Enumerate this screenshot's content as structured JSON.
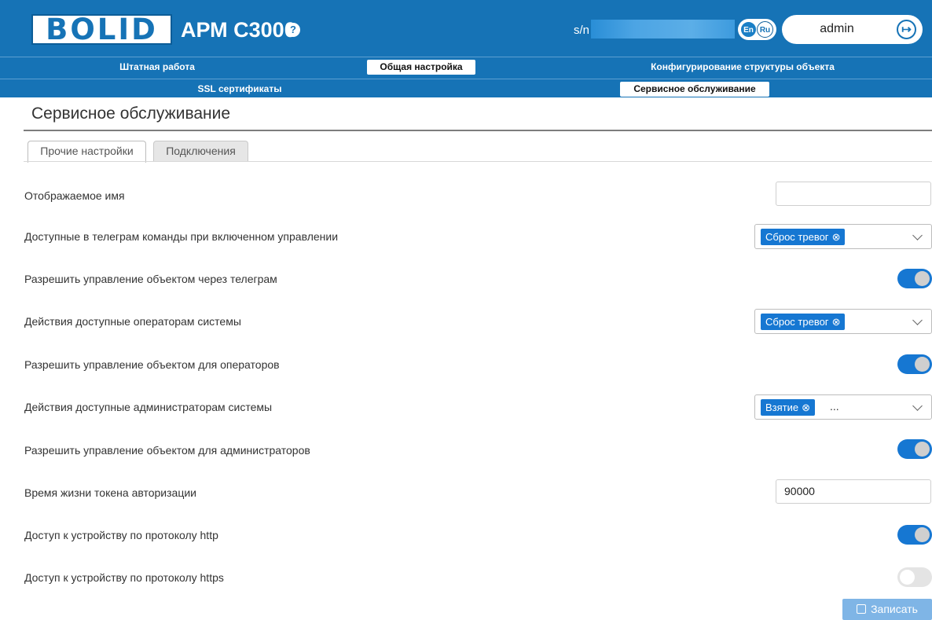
{
  "header": {
    "logo_text": "BOLID",
    "app_title": "АРМ С3000",
    "help_icon": "?",
    "sn_label": "s/n",
    "lang_en": "En",
    "lang_ru": "Ru",
    "user": "admin",
    "brand_color": "#1673b6"
  },
  "nav": {
    "row1": [
      "Штатная работа",
      "Общая настройка",
      "Конфигурирование структуры объекта"
    ],
    "row2": [
      "SSL сертификаты",
      "Сервисное обслуживание"
    ],
    "active_row1": "Общая настройка",
    "active_row2": "Сервисное обслуживание"
  },
  "page": {
    "title": "Сервисное обслуживание",
    "tabs": [
      "Прочие настройки",
      "Подключения"
    ],
    "active_tab": "Прочие настройки"
  },
  "settings": {
    "display_name_label": "Отображаемое имя",
    "display_name_value": "",
    "telegram_commands_label": "Доступные в телеграм команды при включенном управлении",
    "telegram_commands_chip": "Сброс тревог",
    "telegram_control_label": "Разрешить управление объектом через телеграм",
    "telegram_control_on": true,
    "operator_actions_label": "Действия доступные операторам системы",
    "operator_actions_chip": "Сброс тревог",
    "operator_control_label": "Разрешить управление объектом для операторов",
    "operator_control_on": true,
    "admin_actions_label": "Действия доступные администраторам системы",
    "admin_actions_chip": "Взятие",
    "admin_actions_more": "...",
    "admin_control_label": "Разрешить управление объектом для администраторов",
    "admin_control_on": true,
    "token_lifetime_label": "Время жизни токена авторизации",
    "token_lifetime_value": "90000",
    "http_label": "Доступ к устройству по протоколу http",
    "http_on": true,
    "https_label": "Доступ к устройству по протоколу https",
    "https_on": false
  },
  "actions": {
    "save_label": "Записать"
  },
  "icons": {
    "chip_close": "⊗",
    "logout": "logout-icon",
    "save": "save-icon",
    "dropdown": "chevron-down-icon"
  },
  "colors": {
    "accent": "#1677d2",
    "save_button": "#7fb5e6"
  }
}
